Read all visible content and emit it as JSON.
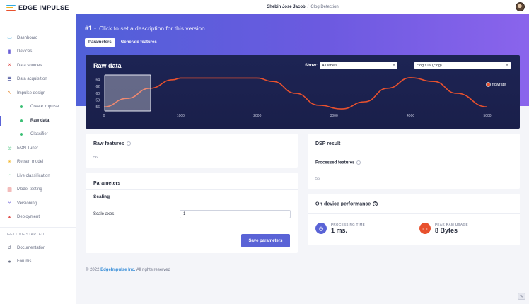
{
  "app": {
    "logo_text": "EDGE IMPULSE",
    "logo_colors": [
      "#2fa9e0",
      "#f2b21c",
      "#e8512e"
    ],
    "accent": "#5a63d6"
  },
  "topbar": {
    "user": "Shebin Jose Jacob",
    "separator": "/",
    "project": "Clog Detection"
  },
  "sidebar": {
    "items": [
      {
        "label": "Dashboard",
        "icon": "dashboard-icon",
        "glyph": "▭",
        "color": "#3aa6d8"
      },
      {
        "label": "Devices",
        "icon": "devices-icon",
        "glyph": "▮",
        "color": "#6a5fd6"
      },
      {
        "label": "Data sources",
        "icon": "data-sources-icon",
        "glyph": "✕",
        "color": "#e0524f"
      },
      {
        "label": "Data acquisition",
        "icon": "data-acquisition-icon",
        "glyph": "☰",
        "color": "#2f3a8f"
      },
      {
        "label": "Impulse design",
        "icon": "impulse-design-icon",
        "glyph": "∿",
        "color": "#e8892e"
      }
    ],
    "subitems": [
      {
        "label": "Create impulse",
        "active": false
      },
      {
        "label": "Raw data",
        "active": true
      },
      {
        "label": "Classifier",
        "active": false
      }
    ],
    "items2": [
      {
        "label": "EON Tuner",
        "icon": "eon-tuner-icon",
        "glyph": "◎",
        "color": "#3bbf74"
      },
      {
        "label": "Retrain model",
        "icon": "retrain-icon",
        "glyph": "✳",
        "color": "#f2b21c"
      },
      {
        "label": "Live classification",
        "icon": "live-classification-icon",
        "glyph": "◔",
        "color": "#3bbf74"
      },
      {
        "label": "Model testing",
        "icon": "model-testing-icon",
        "glyph": "▤",
        "color": "#e0524f"
      },
      {
        "label": "Versioning",
        "icon": "versioning-icon",
        "glyph": "⑂",
        "color": "#6a5fd6"
      },
      {
        "label": "Deployment",
        "icon": "deployment-icon",
        "glyph": "▲",
        "color": "#e0524f"
      }
    ],
    "heading": "GETTING STARTED",
    "items3": [
      {
        "label": "Documentation",
        "icon": "documentation-icon",
        "glyph": "☌",
        "color": "#6b7186"
      },
      {
        "label": "Forums",
        "icon": "forums-icon",
        "glyph": "●",
        "color": "#6b7186"
      }
    ]
  },
  "hero": {
    "version": "#1",
    "caret": "▾",
    "description": "Click to set a description for this version",
    "tabs": [
      {
        "label": "Parameters",
        "active": true
      },
      {
        "label": "Generate features",
        "active": false
      }
    ]
  },
  "raw_data": {
    "title": "Raw data",
    "show_label": "Show:",
    "labels_select": "All labels",
    "sample_select": "clog.s16 (clog)",
    "legend": "flowrate",
    "line_color": "#e8512e"
  },
  "chart_data": {
    "type": "line",
    "x_ticks": [
      0,
      1000,
      2000,
      3000,
      4000,
      5000
    ],
    "y_ticks": [
      56,
      58,
      60,
      62,
      64
    ],
    "xlim": [
      0,
      5000
    ],
    "ylim": [
      55,
      65
    ],
    "series": [
      {
        "name": "flowrate",
        "x": [
          0,
          300,
          600,
          900,
          1000,
          1500,
          2000,
          2200,
          2500,
          2800,
          3100,
          3400,
          3700,
          4000,
          4300,
          4600,
          5000
        ],
        "y": [
          56,
          58.5,
          61.5,
          64,
          64.5,
          64.5,
          64.5,
          63.5,
          60,
          56.5,
          55.4,
          57.5,
          61.5,
          64.6,
          63.5,
          60,
          56
        ]
      }
    ]
  },
  "raw_features": {
    "title": "Raw features",
    "value": "56"
  },
  "parameters": {
    "title": "Parameters",
    "section": "Scaling",
    "scale_label": "Scale axes",
    "scale_value": "1",
    "save_label": "Save parameters"
  },
  "dsp": {
    "title": "DSP result",
    "processed_label": "Processed features",
    "processed_value": "56"
  },
  "performance": {
    "title": "On-device performance",
    "processing_label": "PROCESSING TIME",
    "processing_value": "1 ms.",
    "ram_label": "PEAK RAM USAGE",
    "ram_value": "8 Bytes"
  },
  "footer": {
    "prefix": "© 2022",
    "link": "EdgeImpulse Inc.",
    "suffix": "All rights reserved"
  }
}
